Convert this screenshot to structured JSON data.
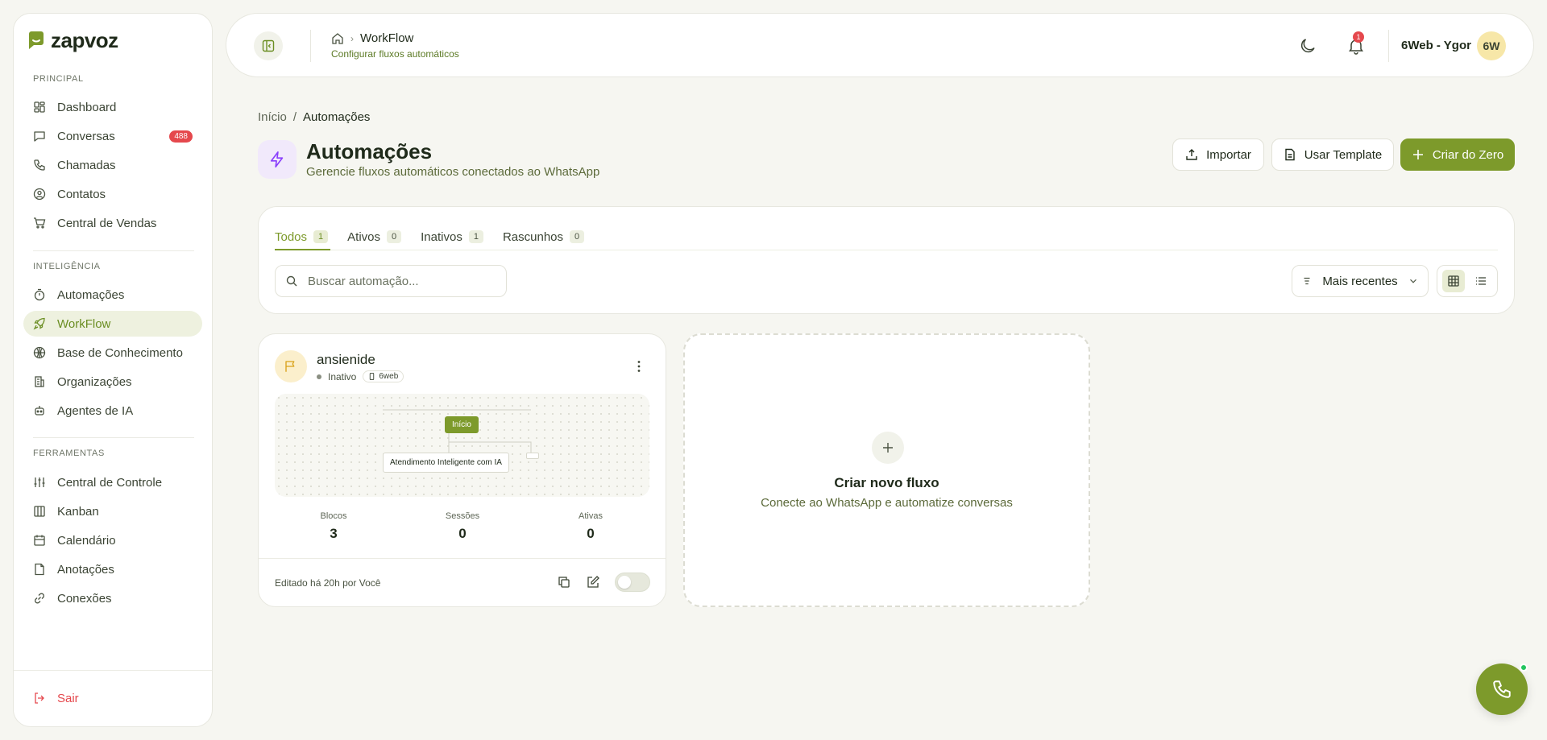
{
  "brand": {
    "name": "zapvoz",
    "color": "#7d9a2b"
  },
  "sidebar": {
    "sections": [
      {
        "label": "PRINCIPAL"
      },
      {
        "label": "INTELIGÊNCIA"
      },
      {
        "label": "FERRAMENTAS"
      }
    ],
    "items": [
      {
        "label": "Dashboard",
        "icon": "dashboard-icon"
      },
      {
        "label": "Conversas",
        "icon": "chat-icon",
        "badge": "488"
      },
      {
        "label": "Chamadas",
        "icon": "phone-icon"
      },
      {
        "label": "Contatos",
        "icon": "contact-icon"
      },
      {
        "label": "Central de Vendas",
        "icon": "cart-icon"
      },
      {
        "label": "Automações",
        "icon": "timer-icon"
      },
      {
        "label": "WorkFlow",
        "icon": "rocket-icon",
        "active": true
      },
      {
        "label": "Base de Conhecimento",
        "icon": "globe-icon"
      },
      {
        "label": "Organizações",
        "icon": "building-icon"
      },
      {
        "label": "Agentes de IA",
        "icon": "bot-icon"
      },
      {
        "label": "Central de Controle",
        "icon": "sliders-icon"
      },
      {
        "label": "Kanban",
        "icon": "kanban-icon"
      },
      {
        "label": "Calendário",
        "icon": "calendar-icon"
      },
      {
        "label": "Anotações",
        "icon": "note-icon"
      },
      {
        "label": "Conexões",
        "icon": "link-icon"
      }
    ],
    "logout": "Sair"
  },
  "header": {
    "crumb": "WorkFlow",
    "subtitle": "Configurar fluxos automáticos",
    "notifications": "1",
    "user": "6Web - Ygor",
    "avatar": "6W"
  },
  "page": {
    "breadcrumb": [
      "Início",
      "/",
      "Automações"
    ],
    "title": "Automações",
    "subtitle": "Gerencie fluxos automáticos conectados ao WhatsApp",
    "buttons": {
      "import": "Importar",
      "template": "Usar Template",
      "create": "Criar do Zero"
    }
  },
  "filters": {
    "tabs": [
      {
        "label": "Todos",
        "count": "1",
        "active": true
      },
      {
        "label": "Ativos",
        "count": "0"
      },
      {
        "label": "Inativos",
        "count": "1"
      },
      {
        "label": "Rascunhos",
        "count": "0"
      }
    ],
    "search_placeholder": "Buscar automação...",
    "sort": "Mais recentes",
    "view": "grid"
  },
  "flows": [
    {
      "name": "ansienide",
      "status": "Inativo",
      "connection": "6web",
      "nodes": {
        "start": "Início",
        "ai": "Atendimento Inteligente com IA"
      },
      "stats": [
        {
          "label": "Blocos",
          "value": "3"
        },
        {
          "label": "Sessões",
          "value": "0"
        },
        {
          "label": "Ativas",
          "value": "0"
        }
      ],
      "edited": "Editado há 20h por Você",
      "enabled": false
    }
  ],
  "new_flow": {
    "title": "Criar novo fluxo",
    "subtitle": "Conecte ao WhatsApp e automatize conversas"
  }
}
